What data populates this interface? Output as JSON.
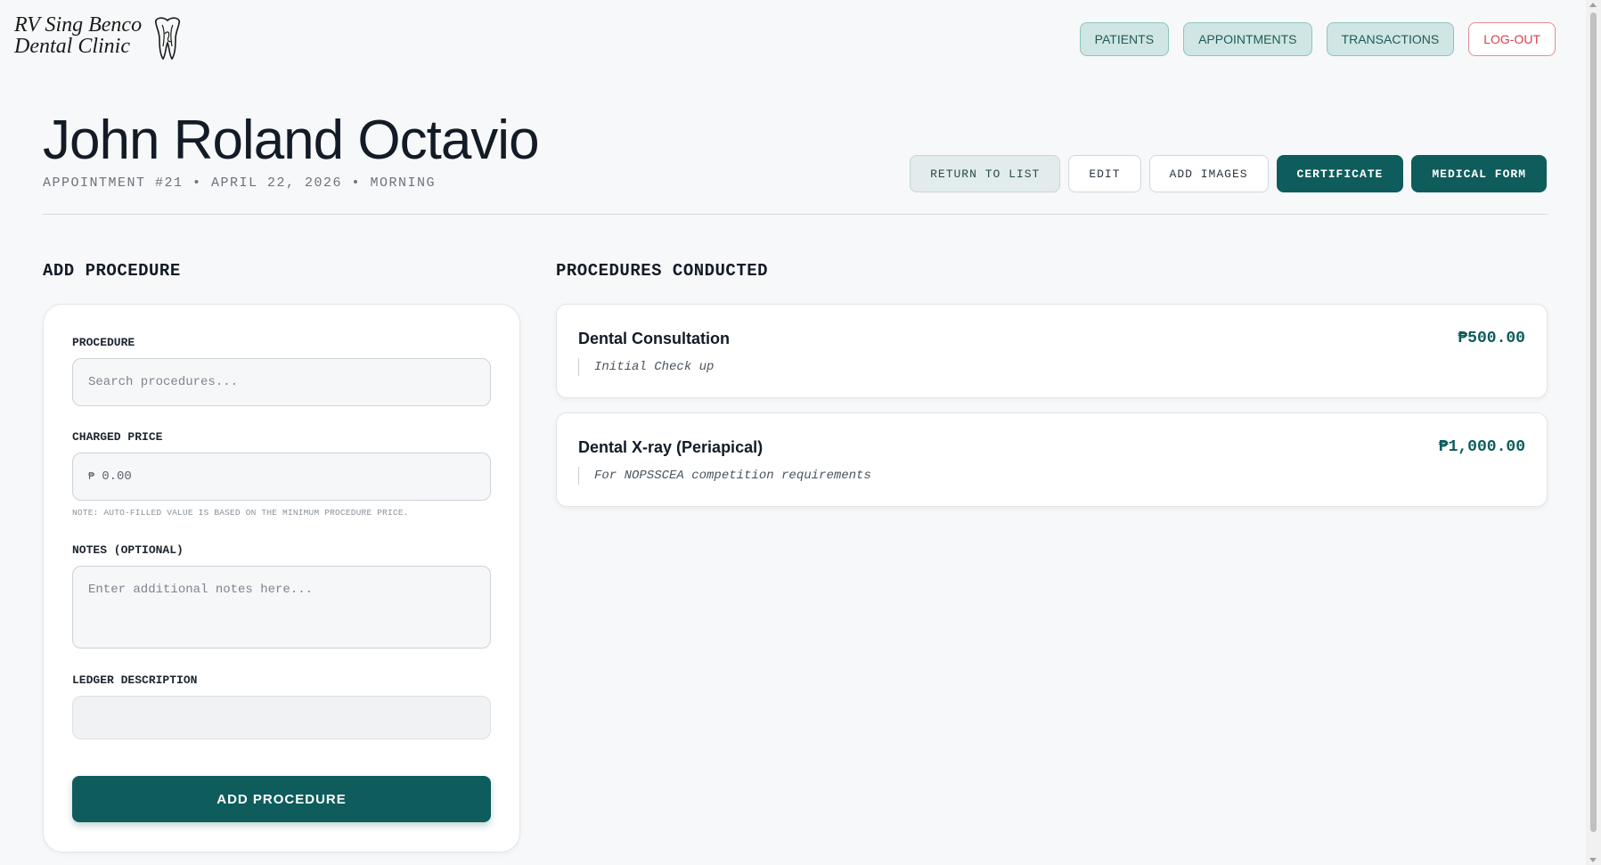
{
  "brand": {
    "line1": "RV Sing Benco",
    "line2": "Dental Clinic",
    "icon": "tooth-icon"
  },
  "nav": {
    "patients": "PATIENTS",
    "appointments": "APPOINTMENTS",
    "transactions": "TRANSACTIONS",
    "logout": "LOG-OUT"
  },
  "header": {
    "patient_name": "John Roland Octavio",
    "appointment_meta": "APPOINTMENT #21 • APRIL 22, 2026 • MORNING"
  },
  "actions": {
    "return": "RETURN TO LIST",
    "edit": "EDIT",
    "add_images": "ADD IMAGES",
    "certificate": "CERTIFICATE",
    "medical_form": "MEDICAL FORM"
  },
  "add_procedure": {
    "heading": "ADD PROCEDURE",
    "procedure_label": "PROCEDURE",
    "procedure_placeholder": "Search procedures...",
    "price_label": "CHARGED PRICE",
    "price_currency": "₱",
    "price_placeholder": "0.00",
    "price_note": "NOTE: AUTO-FILLED VALUE IS BASED ON THE MINIMUM PROCEDURE PRICE.",
    "notes_label": "NOTES (OPTIONAL)",
    "notes_placeholder": "Enter additional notes here...",
    "ledger_label": "LEDGER DESCRIPTION",
    "ledger_value": "",
    "submit": "ADD PROCEDURE"
  },
  "procedures_conducted": {
    "heading": "PROCEDURES CONDUCTED",
    "items": [
      {
        "name": "Dental Consultation",
        "price": "₱500.00",
        "note": "Initial Check up"
      },
      {
        "name": "Dental X-ray (Periapical)",
        "price": "₱1,000.00",
        "note": "For NOPSSCEA competition requirements"
      }
    ]
  },
  "colors": {
    "primary": "#0e5c5c",
    "nav_bg": "#cfe6e4",
    "logout": "#d8404b",
    "background": "#f7f8f9"
  }
}
